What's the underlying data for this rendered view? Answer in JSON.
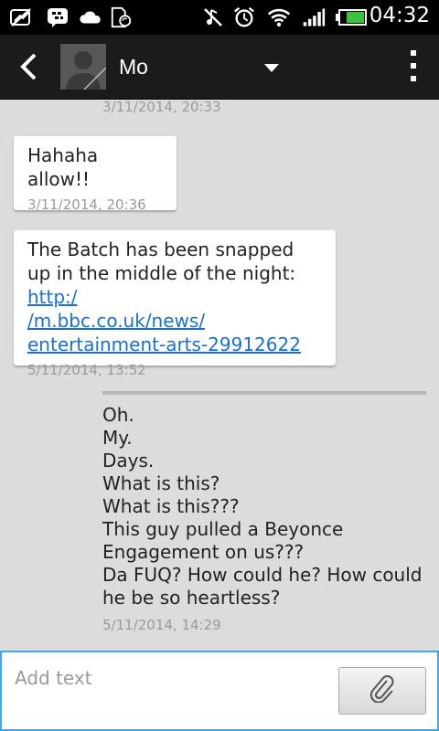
{
  "status_bar": {
    "time": "04:32",
    "icons": [
      "no-signal-icon",
      "bbm-icon",
      "cloud-icon",
      "sd-sync-icon",
      "mute-icon",
      "alarm-icon",
      "wifi-icon",
      "signal-icon",
      "battery-icon"
    ],
    "battery_color": "#39c43b"
  },
  "header": {
    "contact_name": "Mo",
    "icons": [
      "back-icon",
      "avatar-icon",
      "dropdown-icon",
      "overflow-menu-icon"
    ]
  },
  "conversation": {
    "top_timestamp": "3/11/2014, 20:33",
    "messages": [
      {
        "direction": "incoming",
        "text": "Hahaha allow!!",
        "timestamp": "3/11/2014, 20:36"
      },
      {
        "direction": "incoming",
        "text_before": "The Batch has been snapped up in the middle of the night:  ",
        "link_part1": "http:/",
        "link_part2": "/m.bbc.co.uk/news/",
        "link_part3": "entertainment-arts-29912622",
        "timestamp": "5/11/2014, 13:52"
      },
      {
        "direction": "outgoing",
        "lines": [
          "Oh.",
          "My.",
          "Days.",
          "What is this?",
          "What is this???",
          "This guy pulled a Beyonce",
          "Engagement on us???",
          "Da FUQ? How could he? How could",
          "he be so heartless?"
        ],
        "timestamp": "5/11/2014, 14:29"
      }
    ]
  },
  "composer": {
    "placeholder": "Add text",
    "attach_icon": "paperclip-icon",
    "accent": "#3fa8e6"
  },
  "colors": {
    "link": "#1a6fd1",
    "background": "#dcdcdc",
    "bubble": "#ffffff"
  }
}
